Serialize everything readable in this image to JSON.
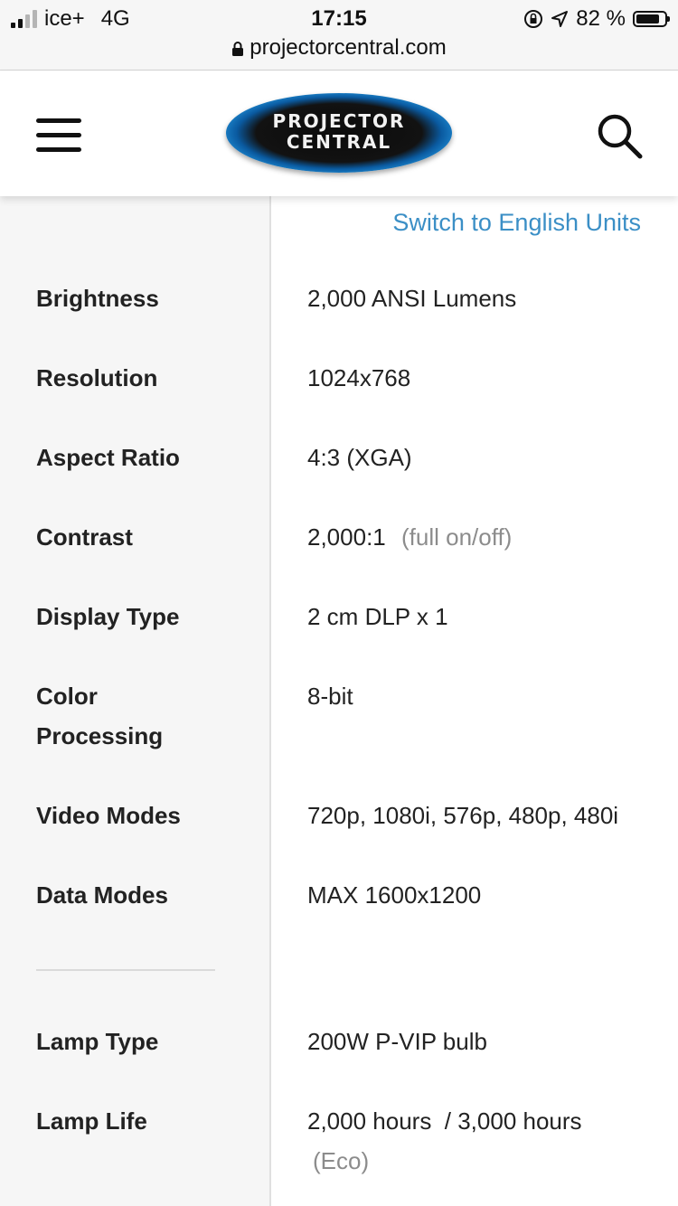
{
  "status_bar": {
    "carrier": "ice+",
    "network": "4G",
    "time": "17:15",
    "battery_percent": "82 %",
    "battery_level": 0.82,
    "url": "projectorcentral.com"
  },
  "header": {
    "logo_line1": "PROJECTOR",
    "logo_line2": "CENTRAL",
    "menu_icon": "hamburger-icon",
    "search_icon": "search-icon"
  },
  "units_link": "Switch to English Units",
  "specs": [
    {
      "label": "Brightness",
      "value": "2,000 ANSI Lumens"
    },
    {
      "label": "Resolution",
      "value": "1024x768"
    },
    {
      "label": "Aspect Ratio",
      "value": "4:3 (XGA)"
    },
    {
      "label": "Contrast",
      "value": "2,000:1",
      "note": "(full on/off)"
    },
    {
      "label": "Display Type",
      "value": "2 cm DLP x 1"
    },
    {
      "label_line1": "Color",
      "label_line2": "Processing",
      "value": "8-bit"
    },
    {
      "label": "Video Modes",
      "value": "720p, 1080i, 576p, 480p, 480i"
    },
    {
      "label": "Data Modes",
      "value": "MAX 1600x1200"
    },
    {
      "label": "Lamp Type",
      "value": "200W P-VIP bulb"
    },
    {
      "label": "Lamp Life",
      "value": "2,000 hours  / 3,000 hours",
      "note": "(Eco)"
    }
  ],
  "colors": {
    "link": "#3b8fc6",
    "muted": "#8c8c8c",
    "left_column_bg": "#f6f6f6"
  }
}
